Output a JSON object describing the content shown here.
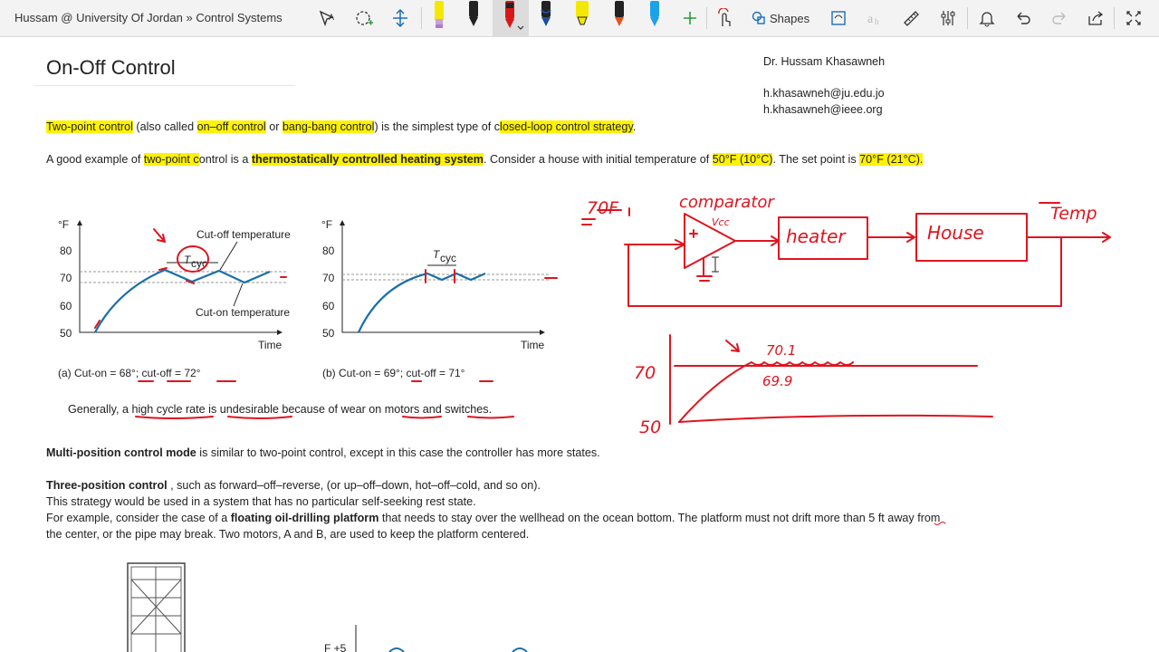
{
  "window": {
    "breadcrumb": "Hussam @ University Of Jordan » Control Systems"
  },
  "toolbar": {
    "shapes_label": "Shapes",
    "icons": [
      "lasso-select-icon",
      "add-space-icon",
      "insert-space-icon",
      "pen-icon",
      "pen-icon",
      "pen-icon",
      "pen-icon",
      "highlighter-icon",
      "pen-icon",
      "pen-icon",
      "add-pen-icon",
      "touch-draw-icon",
      "shapes-icon",
      "ink-to-shape-icon",
      "ink-to-math-icon",
      "ruler-icon",
      "settings-icon",
      "bell-icon",
      "undo-icon",
      "redo-icon",
      "share-icon",
      "fullscreen-icon"
    ],
    "pen_colors": [
      "#c8a2d8",
      "#222222",
      "#d81818",
      "#1a4f9c",
      "#f5e800",
      "#e8501a",
      "#1da1e8"
    ]
  },
  "page": {
    "title": "On-Off Control",
    "author": {
      "name": "Dr. Hussam Khasawneh",
      "email1": "h.khasawneh@ju.edu.jo",
      "email2": "h.khasawneh@ieee.org"
    },
    "p1": {
      "a": "Two-point control",
      "b": " (also called ",
      "c": "on–off control",
      "d": " or ",
      "e": "bang-bang control",
      "f": ") is the simplest type of c",
      "g": "losed-loop control strategy",
      "h": "."
    },
    "p2": {
      "a": "A good example of ",
      "b": "two-point c",
      "c": "ontrol is a ",
      "d": "thermostatically controlled heating system",
      "e": ". Consider a house with initial temperature of ",
      "f": "50°F (10°C)",
      "g": ". The set point is ",
      "h": "70°F (21°C)."
    },
    "figure": {
      "unit": "°F",
      "y_ticks": [
        "80",
        "70",
        "60",
        "50"
      ],
      "x_label": "Time",
      "t_cyc_main": "T",
      "t_cyc_sub": "cyc",
      "cutoff_label": "Cut-off temperature",
      "cuton_label": "Cut-on temperature",
      "caption_a": "(a)   Cut-on = 68°; cut-off = 72°",
      "caption_b": "(b)   Cut-on = 69°; cut-off = 71°"
    },
    "p3": "Generally, a high cycle rate is undesirable because of wear on motors and switches.",
    "p4": {
      "bold": "Multi-position control mode",
      "rest": " is similar to two-point control, except in this case the controller has more states."
    },
    "p5": {
      "bold": "Three-position control",
      "rest": " , such as forward–off–reverse, (or up–off–down, hot–off–cold, and so on)."
    },
    "p6": "This strategy would be used in a system that has no particular self-seeking rest state.",
    "p7": {
      "a": "For example, consider the case of a ",
      "bold": "floating oil-drilling platform",
      "b": " that needs to stay over the wellhead on the ocean bottom. The platform must not drift more than 5 ft away from"
    },
    "p8": "the center, or the pipe may break. Two motors, A and B, are used to keep the platform centered.",
    "bottom_fig_label": "F +5"
  },
  "annotations": {
    "setpoint": "70F",
    "comparator": "comparator",
    "vcc": "Vcc",
    "heater": "heater",
    "house": "House",
    "temp": "Temp",
    "y70": "70",
    "y50": "50",
    "v70": "70.1",
    "v69": "69.9",
    "ink_color": "#e0141e"
  }
}
